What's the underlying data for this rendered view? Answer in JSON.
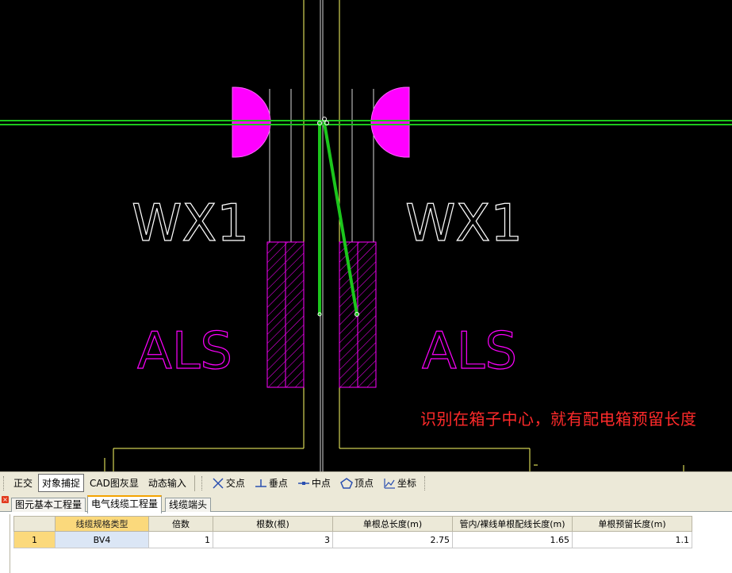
{
  "cad": {
    "labels": {
      "box_left": "WX1",
      "box_right": "WX1",
      "panel_left": "ALS",
      "panel_right": "ALS"
    },
    "annotation": "识别在箱子中心，就有配电箱预留长度",
    "colors": {
      "background": "#000000",
      "wire": "#1cc61c",
      "wall": "#ffff66",
      "magenta": "#ff00ff",
      "outline": "#ffffff",
      "annotation": "#ff2a2a"
    }
  },
  "snapbar": {
    "items": [
      {
        "label": "正交",
        "icon": ""
      },
      {
        "label": "对象捕捉",
        "icon": ""
      },
      {
        "label": "CAD图灰显",
        "icon": ""
      },
      {
        "label": "动态输入",
        "icon": ""
      },
      {
        "label": "交点",
        "icon": "intersection-icon"
      },
      {
        "label": "垂点",
        "icon": "perpendicular-icon"
      },
      {
        "label": "中点",
        "icon": "midpoint-icon"
      },
      {
        "label": "顶点",
        "icon": "vertex-icon"
      },
      {
        "label": "坐标",
        "icon": "coordinate-icon"
      }
    ]
  },
  "tabs": [
    {
      "label": "图元基本工程量"
    },
    {
      "label": "电气线缆工程量"
    },
    {
      "label": "线缆端头"
    }
  ],
  "table": {
    "headers": [
      "线缆规格类型",
      "倍数",
      "根数(根)",
      "单根总长度(m)",
      "管内/裸线单根配线长度(m)",
      "单根预留长度(m)"
    ],
    "rows": [
      {
        "num": "1",
        "spec": "BV4",
        "multiple": "1",
        "count": "3",
        "total": "2.75",
        "inner": "1.65",
        "reserve": "1.1"
      }
    ]
  }
}
